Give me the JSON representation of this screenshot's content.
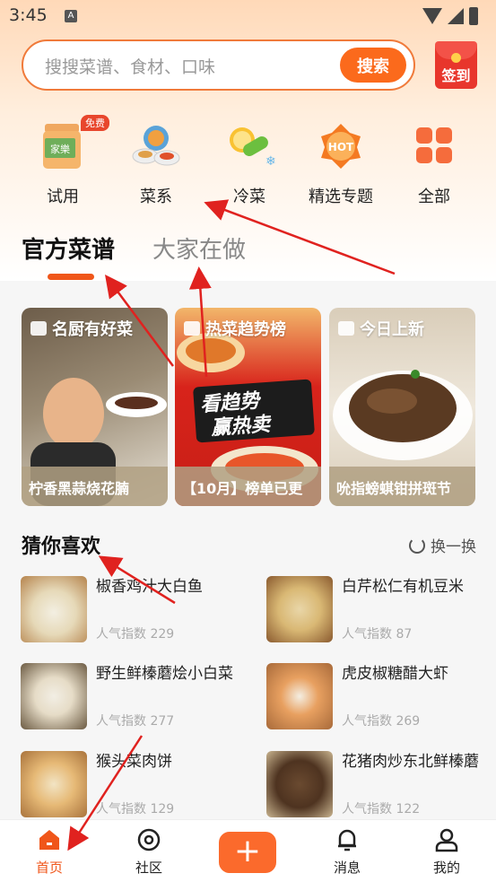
{
  "status_bar": {
    "time": "3:45",
    "notification_letter": "A"
  },
  "search": {
    "placeholder": "搜搜菜谱、食材、口味",
    "button": "搜索"
  },
  "checkin": {
    "label": "签到"
  },
  "categories": [
    {
      "label": "试用",
      "icon": "trial-box-icon",
      "badge": "免费"
    },
    {
      "label": "菜系",
      "icon": "cuisine-plates-icon"
    },
    {
      "label": "冷菜",
      "icon": "cold-dish-icon"
    },
    {
      "label": "精选专题",
      "icon": "hot-topic-icon",
      "badge": "HOT"
    },
    {
      "label": "全部",
      "icon": "grid-all-icon"
    }
  ],
  "trial_box_text": "家樂",
  "tabs": {
    "official": "官方菜谱",
    "others": "大家在做"
  },
  "feature_cards": [
    {
      "title": "名厨有好菜",
      "footer": "柠香黑蒜烧花腩",
      "colors": [
        "#7a6a55",
        "#e8e2d6"
      ]
    },
    {
      "title": "热菜趋势榜",
      "footer": "【10月】榜单已更",
      "banner": [
        "看趋势",
        "赢热卖"
      ],
      "colors": [
        "#d8231b",
        "#f2b66a"
      ]
    },
    {
      "title": "今日上新",
      "footer": "吮指螃蜞钳拼斑节",
      "colors": [
        "#6b4a2e",
        "#e9e0d2"
      ]
    }
  ],
  "guess": {
    "title": "猜你喜欢",
    "refresh": "换一换"
  },
  "recipes": [
    {
      "name": "椒香鸡汁大白鱼",
      "pop": "人气指数 229",
      "colors": [
        "#c89a5a",
        "#f3efe2"
      ]
    },
    {
      "name": "白芹松仁有机豆米",
      "pop": "人气指数 87",
      "colors": [
        "#b9853f",
        "#e7d2a4"
      ]
    },
    {
      "name": "野生鲜榛蘑烩小白菜",
      "pop": "人气指数 277",
      "colors": [
        "#6b5a42",
        "#efe9dc"
      ]
    },
    {
      "name": "虎皮椒糖醋大虾",
      "pop": "人气指数 269",
      "colors": [
        "#b87645",
        "#f1e9dc"
      ]
    },
    {
      "name": "猴头菜肉饼",
      "pop": "人气指数 129",
      "colors": [
        "#c9924b",
        "#f0e1c0"
      ]
    },
    {
      "name": "花猪肉炒东北鲜榛蘑",
      "pop": "人气指数 122",
      "colors": [
        "#5b3e26",
        "#d8c4a3"
      ]
    }
  ],
  "bottom_nav": {
    "home": "首页",
    "community": "社区",
    "plus": "+",
    "messages": "消息",
    "mine": "我的"
  },
  "accent_color": "#fb6a1c",
  "annotation_color": "#e0221f"
}
